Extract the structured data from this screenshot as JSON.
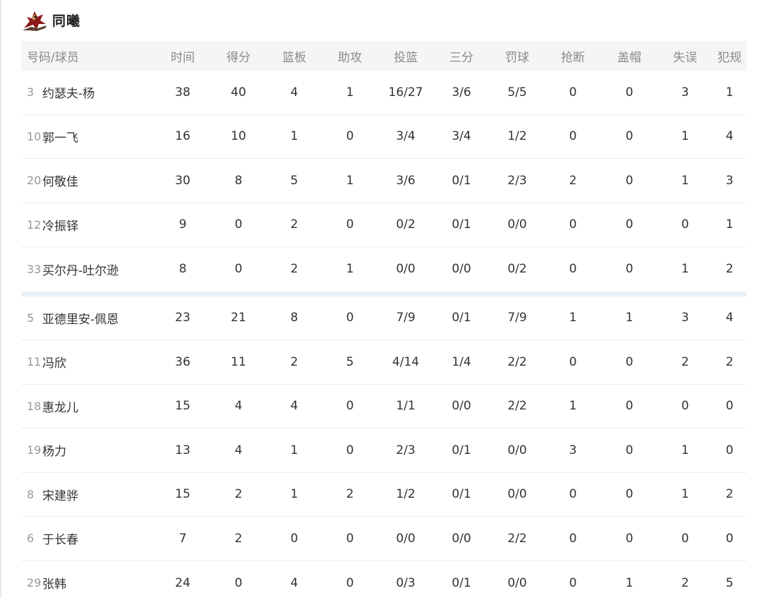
{
  "team": {
    "name": "同曦",
    "logo_icon": "dragon-team-logo-icon",
    "logo_colors": {
      "primary": "#8b1a1a",
      "accent": "#c8a25a"
    }
  },
  "columns": {
    "player": "号码/球员",
    "time": "时间",
    "pts": "得分",
    "reb": "篮板",
    "ast": "助攻",
    "fg": "投篮",
    "three": "三分",
    "ft": "罚球",
    "stl": "抢断",
    "blk": "盖帽",
    "tov": "失误",
    "pf": "犯规"
  },
  "starters": [
    {
      "num": "3",
      "name": "约瑟夫-杨",
      "time": "38",
      "pts": "40",
      "reb": "4",
      "ast": "1",
      "fg": "16/27",
      "three": "3/6",
      "ft": "5/5",
      "stl": "0",
      "blk": "0",
      "tov": "3",
      "pf": "1"
    },
    {
      "num": "10",
      "name": "郭一飞",
      "time": "16",
      "pts": "10",
      "reb": "1",
      "ast": "0",
      "fg": "3/4",
      "three": "3/4",
      "ft": "1/2",
      "stl": "0",
      "blk": "0",
      "tov": "1",
      "pf": "4"
    },
    {
      "num": "20",
      "name": "何敬佳",
      "time": "30",
      "pts": "8",
      "reb": "5",
      "ast": "1",
      "fg": "3/6",
      "three": "0/1",
      "ft": "2/3",
      "stl": "2",
      "blk": "0",
      "tov": "1",
      "pf": "3"
    },
    {
      "num": "12",
      "name": "冷振铎",
      "time": "9",
      "pts": "0",
      "reb": "2",
      "ast": "0",
      "fg": "0/2",
      "three": "0/1",
      "ft": "0/0",
      "stl": "0",
      "blk": "0",
      "tov": "0",
      "pf": "1"
    },
    {
      "num": "33",
      "name": "买尔丹-吐尔逊",
      "time": "8",
      "pts": "0",
      "reb": "2",
      "ast": "1",
      "fg": "0/0",
      "three": "0/0",
      "ft": "0/2",
      "stl": "0",
      "blk": "0",
      "tov": "1",
      "pf": "2"
    }
  ],
  "bench": [
    {
      "num": "5",
      "name": "亚德里安-佩恩",
      "time": "23",
      "pts": "21",
      "reb": "8",
      "ast": "0",
      "fg": "7/9",
      "three": "0/1",
      "ft": "7/9",
      "stl": "1",
      "blk": "1",
      "tov": "3",
      "pf": "4"
    },
    {
      "num": "11",
      "name": "冯欣",
      "time": "36",
      "pts": "11",
      "reb": "2",
      "ast": "5",
      "fg": "4/14",
      "three": "1/4",
      "ft": "2/2",
      "stl": "0",
      "blk": "0",
      "tov": "2",
      "pf": "2"
    },
    {
      "num": "18",
      "name": "惠龙儿",
      "time": "15",
      "pts": "4",
      "reb": "4",
      "ast": "0",
      "fg": "1/1",
      "three": "0/0",
      "ft": "2/2",
      "stl": "1",
      "blk": "0",
      "tov": "0",
      "pf": "0"
    },
    {
      "num": "19",
      "name": "杨力",
      "time": "13",
      "pts": "4",
      "reb": "1",
      "ast": "0",
      "fg": "2/3",
      "three": "0/1",
      "ft": "0/0",
      "stl": "3",
      "blk": "0",
      "tov": "1",
      "pf": "0"
    },
    {
      "num": "8",
      "name": "宋建骅",
      "time": "15",
      "pts": "2",
      "reb": "1",
      "ast": "2",
      "fg": "1/2",
      "three": "0/1",
      "ft": "0/0",
      "stl": "0",
      "blk": "0",
      "tov": "1",
      "pf": "2"
    },
    {
      "num": "6",
      "name": "于长春",
      "time": "7",
      "pts": "2",
      "reb": "0",
      "ast": "0",
      "fg": "0/0",
      "three": "0/0",
      "ft": "2/2",
      "stl": "0",
      "blk": "0",
      "tov": "0",
      "pf": "0"
    },
    {
      "num": "29",
      "name": "张韩",
      "time": "24",
      "pts": "0",
      "reb": "4",
      "ast": "0",
      "fg": "0/3",
      "three": "0/1",
      "ft": "0/0",
      "stl": "0",
      "blk": "1",
      "tov": "2",
      "pf": "5"
    }
  ]
}
